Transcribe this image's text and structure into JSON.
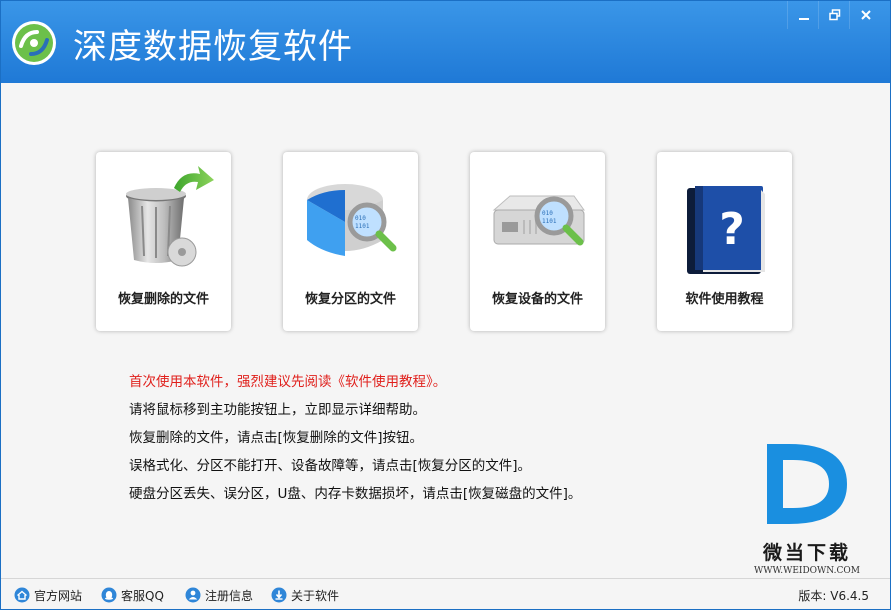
{
  "window": {
    "title": "深度数据恢复软件"
  },
  "cards": [
    {
      "label": "恢复删除的文件",
      "icon": "trash-restore-icon"
    },
    {
      "label": "恢复分区的文件",
      "icon": "partition-search-icon"
    },
    {
      "label": "恢复设备的文件",
      "icon": "device-search-icon"
    },
    {
      "label": "软件使用教程",
      "icon": "help-book-icon"
    }
  ],
  "tips": [
    "首次使用本软件，强烈建议先阅读《软件使用教程》。",
    "请将鼠标移到主功能按钮上，立即显示详细帮助。",
    "恢复删除的文件，请点击[恢复删除的文件]按钮。",
    "误格式化、分区不能打开、设备故障等，请点击[恢复分区的文件]。",
    "硬盘分区丢失、误分区，U盘、内存卡数据损坏，请点击[恢复磁盘的文件]。"
  ],
  "watermark": {
    "name": "微当下载",
    "url": "WWW.WEIDOWN.COM"
  },
  "statusbar": {
    "links": [
      {
        "label": "官方网站",
        "icon": "home-icon"
      },
      {
        "label": "客服QQ",
        "icon": "qq-icon"
      },
      {
        "label": "注册信息",
        "icon": "user-icon"
      },
      {
        "label": "关于软件",
        "icon": "info-icon"
      }
    ],
    "version": "版本: V6.4.5"
  },
  "colors": {
    "titlebar": "#2185dc",
    "tip_highlight": "#e0201c",
    "brand_blue": "#1a8fe0"
  }
}
